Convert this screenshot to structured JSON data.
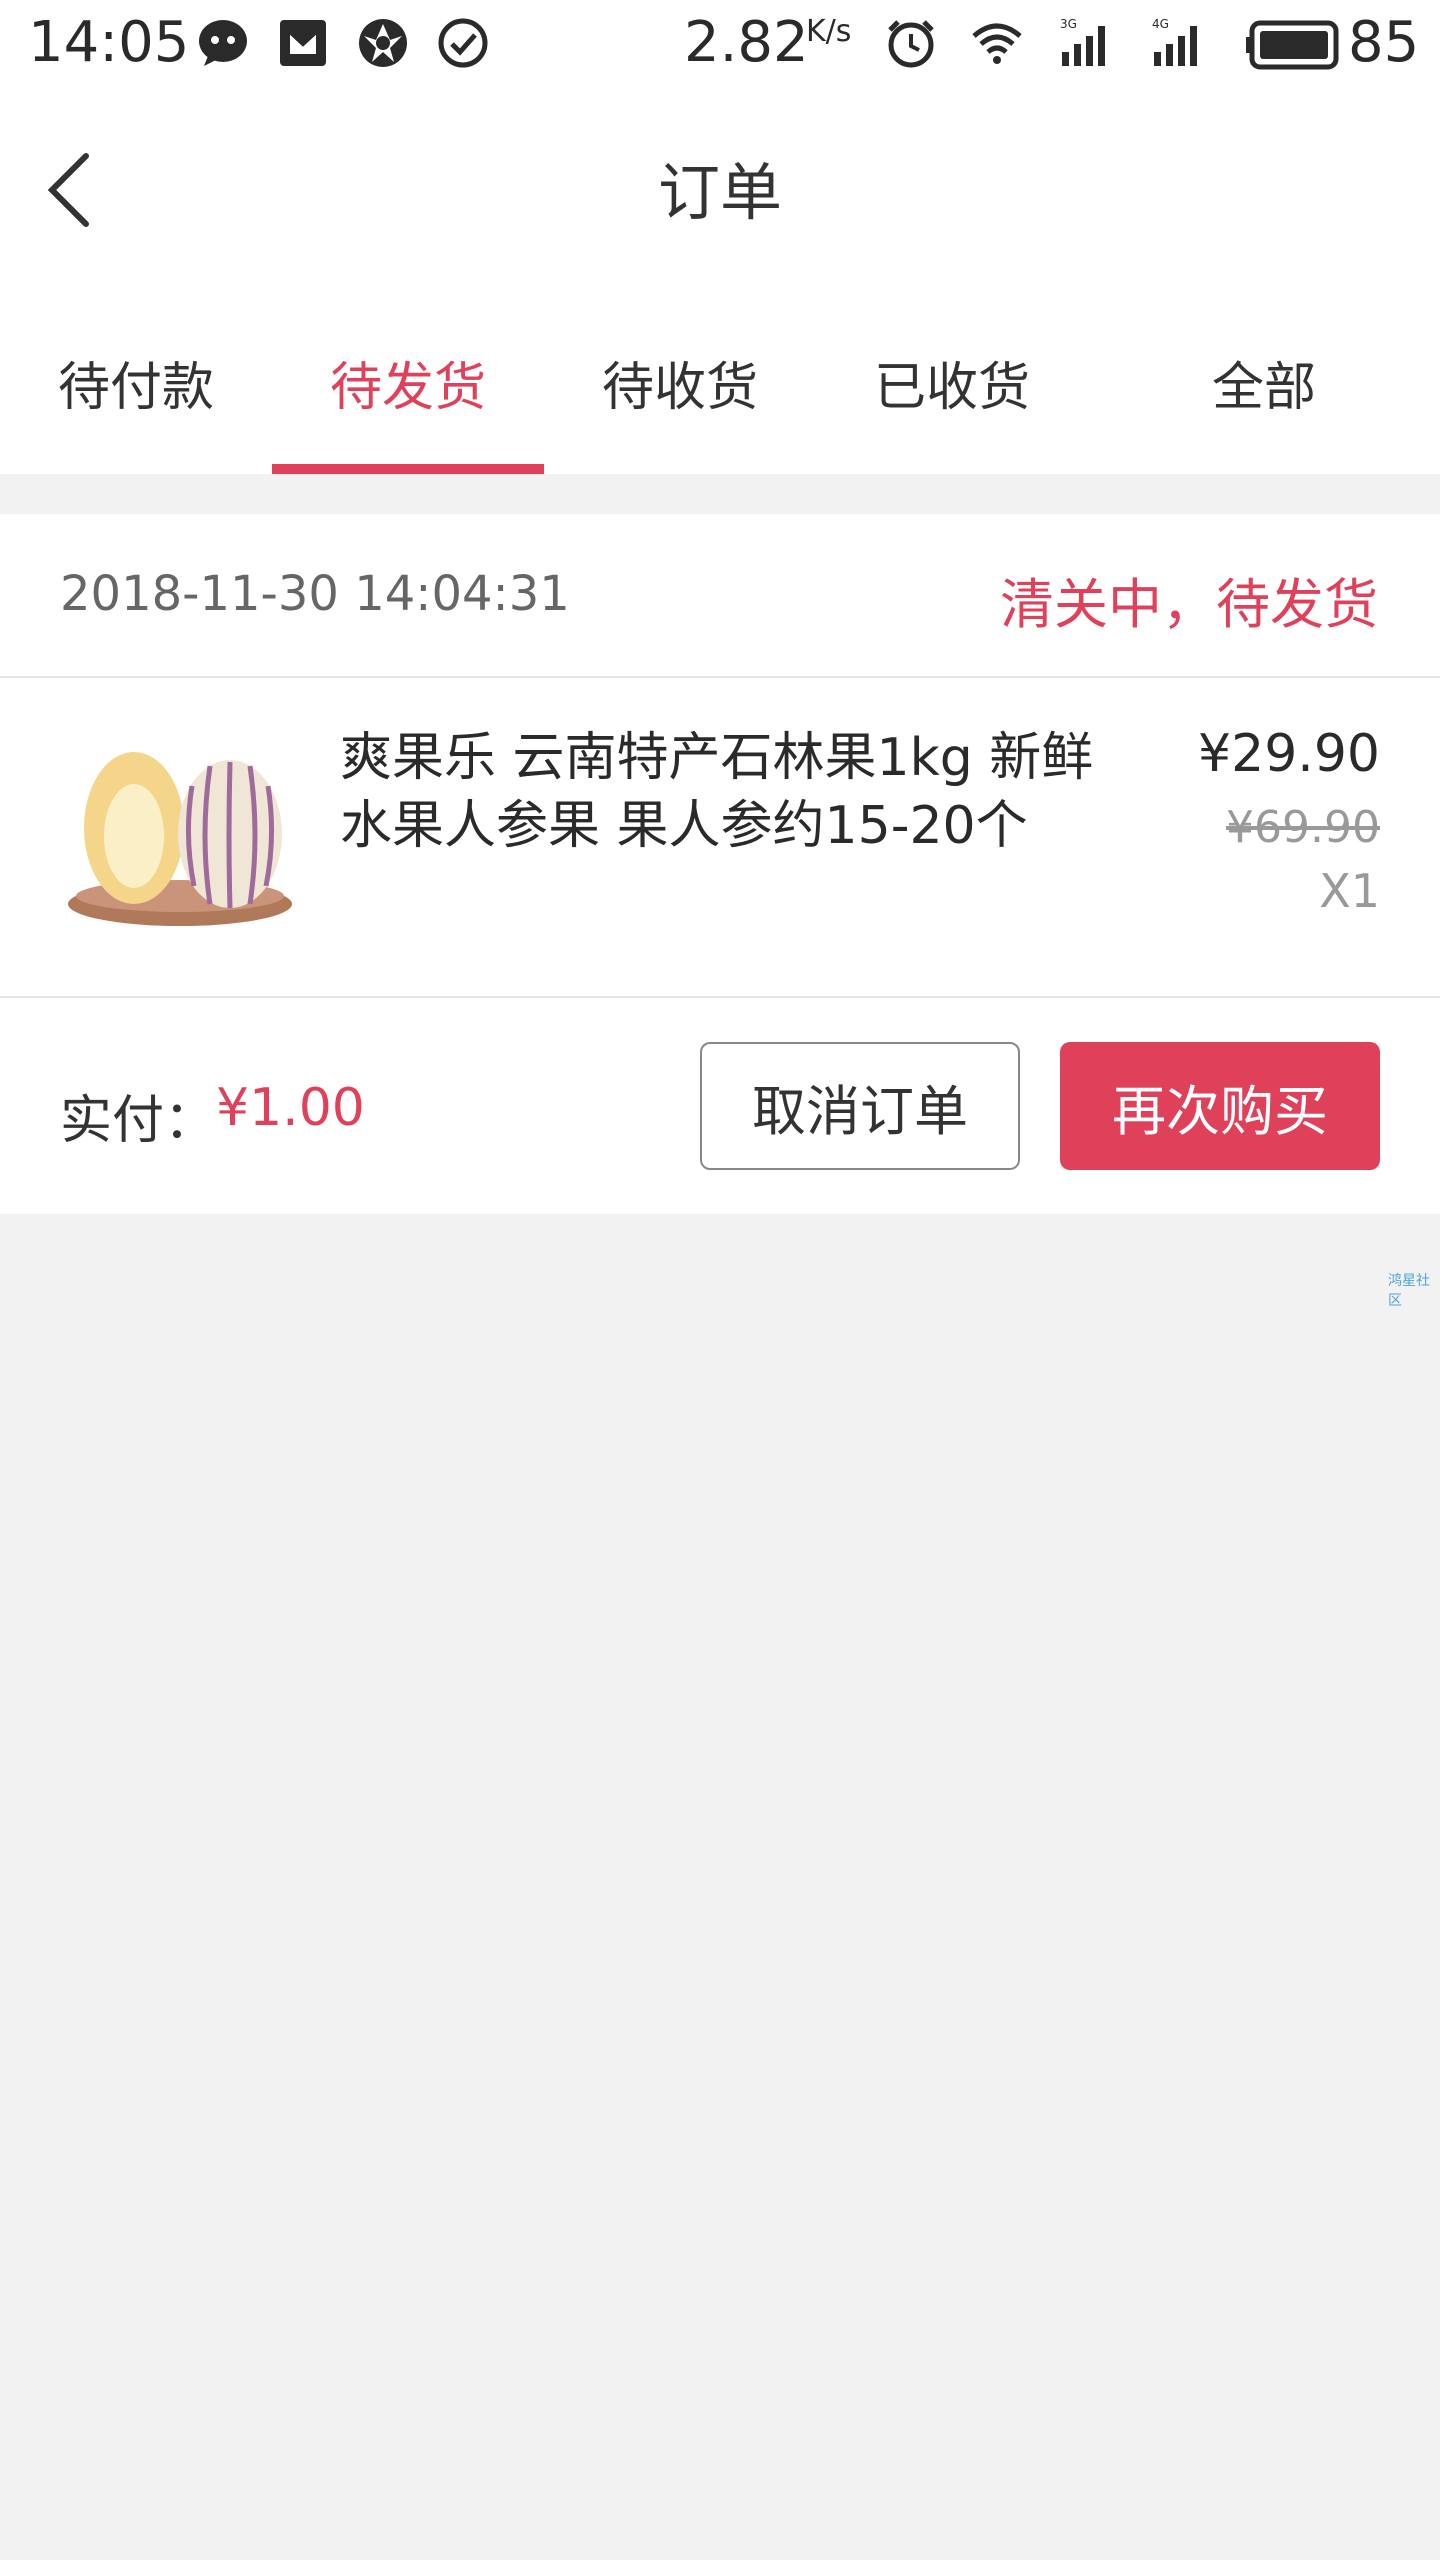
{
  "status_bar": {
    "time": "14:05",
    "speed": "2.82",
    "speed_unit": "K/s",
    "battery": "85",
    "icons": [
      "chat-icon",
      "shield-icon",
      "aperture-icon",
      "check-circle-icon",
      "alarm-icon",
      "wifi-icon",
      "signal-3g-icon",
      "signal-4g-icon",
      "battery-icon"
    ]
  },
  "header": {
    "title": "订单",
    "back_icon": "chevron-left-icon"
  },
  "tabs": [
    {
      "label": "待付款",
      "active": false
    },
    {
      "label": "待发货",
      "active": true
    },
    {
      "label": "待收货",
      "active": false
    },
    {
      "label": "已收货",
      "active": false
    },
    {
      "label": "全部",
      "active": false
    }
  ],
  "order": {
    "time": "2018-11-30 14:04:31",
    "status": "清关中，待发货",
    "product": {
      "name": "爽果乐 云南特产石林果1kg 新鲜水果人参果 果人参约15-20个",
      "price": "¥29.90",
      "original_price": "¥69.90",
      "quantity": "X1"
    },
    "paid_label": "实付：",
    "paid_value": "¥1.00",
    "cancel_label": "取消订单",
    "rebuy_label": "再次购买"
  },
  "watermark": "鸿星社区",
  "colors": {
    "accent": "#e0415a",
    "background": "#f2f2f2",
    "text": "#333333",
    "muted": "#999999"
  }
}
